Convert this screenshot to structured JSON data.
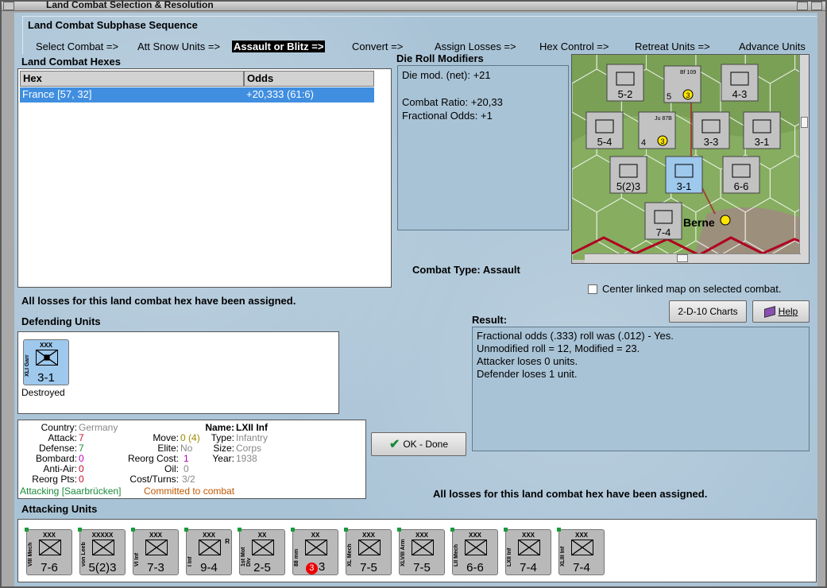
{
  "window": {
    "title": "Land Combat Selection & Resolution"
  },
  "sequence": {
    "title": "Land Combat Subphase Sequence",
    "steps": [
      "Select Combat =>",
      "Att Snow Units =>",
      "Assault or Blitz =>",
      "Convert =>",
      "Assign Losses =>",
      "Hex Control =>",
      "Retreat Units =>",
      "Advance Units"
    ],
    "active_index": 2
  },
  "hexes": {
    "title": "Land Combat Hexes",
    "columns": [
      "Hex",
      "Odds"
    ],
    "rows": [
      {
        "hex": "France [57, 32]",
        "odds": "+20,333 (61:6)"
      }
    ]
  },
  "die_roll": {
    "title": "Die Roll Modifiers",
    "lines": [
      "Die mod. (net): +21",
      "",
      "Combat Ratio: +20,33",
      "Fractional Odds: +1"
    ]
  },
  "combat_type": {
    "label": "Combat Type:",
    "value": "Assault"
  },
  "center_map": {
    "label": "Center linked map on selected combat.",
    "checked": false
  },
  "buttons": {
    "charts": "2-D-10 Charts",
    "help": "Help",
    "ok": "OK - Done"
  },
  "loss_msg": "All losses for this land combat hex have been assigned.",
  "defending": {
    "title": "Defending Units",
    "units": [
      {
        "size": "XXX",
        "name": "XLI Garr",
        "value": "3-1",
        "status": "Destroyed"
      }
    ]
  },
  "result": {
    "title": "Result:",
    "lines": [
      "Fractional odds (.333) roll was (.012)  - Yes.",
      "Unmodified roll = 12, Modified = 23.",
      "Attacker loses 0 units.",
      "Defender loses 1 unit."
    ]
  },
  "info": {
    "country_label": "Country:",
    "country": "Germany",
    "attack_label": "Attack:",
    "attack": "7",
    "defense_label": "Defense:",
    "defense": "7",
    "bombard_label": "Bombard:",
    "bombard": "0",
    "antiair_label": "Anti-Air:",
    "antiair": "0",
    "reorgpts_label": "Reorg Pts:",
    "reorgpts": "0",
    "move_label": "Move:",
    "move": "0",
    "move_extra": "(4)",
    "elite_label": "Elite:",
    "elite": "No",
    "reorgcost_label": "Reorg Cost:",
    "reorgcost": "1",
    "oil_label": "Oil:",
    "oil": "0",
    "costturns_label": "Cost/Turns:",
    "costturns": "3/2",
    "name_label": "Name:",
    "name": "LXII Inf",
    "type_label": "Type:",
    "type": "Infantry",
    "size_label": "Size:",
    "size": "Corps",
    "year_label": "Year:",
    "year": "1938",
    "attacking_text": "Attacking [Saarbrücken]",
    "committed_text": "Committed to combat"
  },
  "attacking": {
    "title": "Attacking Units",
    "units": [
      {
        "size": "XXX",
        "name": "VIII Mech",
        "value": "7-6",
        "tag": ""
      },
      {
        "size": "XXXXX",
        "name": "von Leeb",
        "value": "5(2)3",
        "tag": ""
      },
      {
        "size": "XXX",
        "name": "VI Inf",
        "value": "7-3",
        "tag": ""
      },
      {
        "size": "XXX",
        "name": "I Inf",
        "value": "9-4",
        "tag": "R"
      },
      {
        "size": "XX",
        "name": "1st Mot Div",
        "value": "2-5",
        "tag": ""
      },
      {
        "size": "XX",
        "name": "88 mm",
        "value": "3",
        "tag": "",
        "badge": "3"
      },
      {
        "size": "XXX",
        "name": "XL Mech",
        "value": "7-5",
        "tag": ""
      },
      {
        "size": "XXX",
        "name": "XLVIII Arm",
        "value": "7-5",
        "tag": ""
      },
      {
        "size": "XXX",
        "name": "LII Mech",
        "value": "6-6",
        "tag": ""
      },
      {
        "size": "XXX",
        "name": "LXII Inf",
        "value": "7-4",
        "tag": ""
      },
      {
        "size": "XXX",
        "name": "XLIII Inf",
        "value": "7-4",
        "tag": ""
      }
    ]
  },
  "map": {
    "city": "Berne",
    "counters": [
      "5-2",
      "4-3",
      "5-4",
      "3-3",
      "3-1",
      "5(2)3",
      "3-1",
      "6-6",
      "7-4"
    ],
    "air": [
      {
        "name": "Bf 109",
        "value": "5",
        "badge": "3"
      },
      {
        "name": "Ju 87B",
        "value": "4",
        "badge": "3"
      }
    ]
  },
  "colors": {
    "accent": "#3f8ee0",
    "bg": "#a9c3d6",
    "unit": "#b9b9b9",
    "defender": "#9ec8ec"
  }
}
